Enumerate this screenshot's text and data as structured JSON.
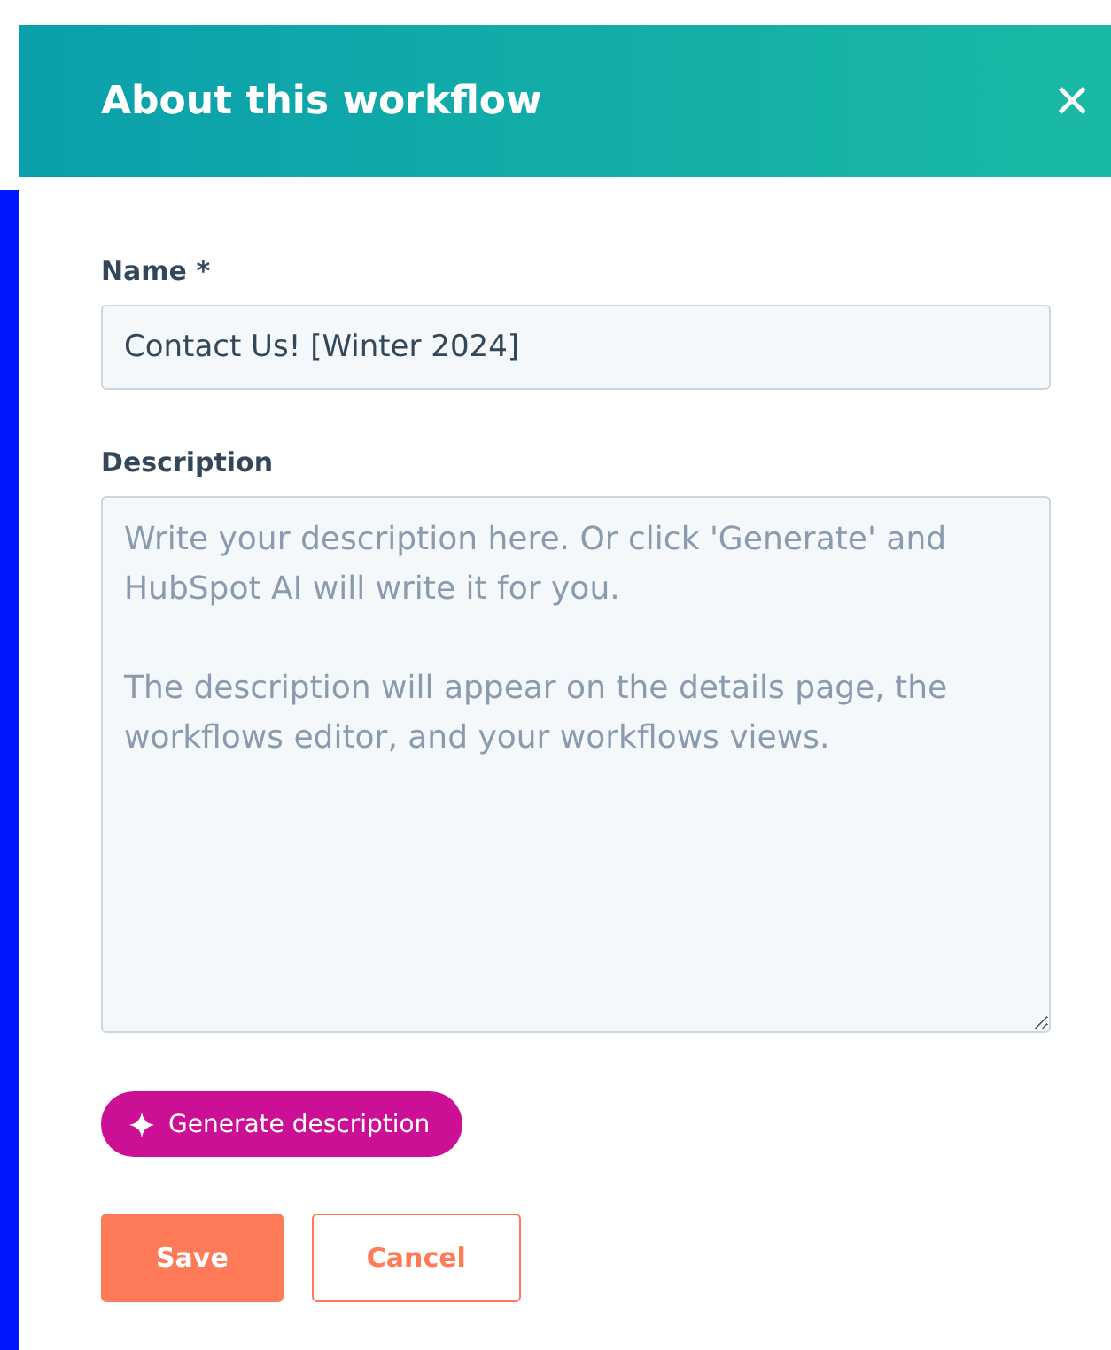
{
  "header": {
    "title": "About this workflow",
    "close": "×"
  },
  "name_field": {
    "label": "Name *",
    "value": "Contact Us! [Winter 2024]"
  },
  "description_field": {
    "label": "Description",
    "placeholder": "Write your description here. Or click 'Generate' and HubSpot AI will write it for you.\n\nThe description will appear on the details page, the workflows editor, and your workflows views."
  },
  "generate_button": {
    "label": "Generate description"
  },
  "buttons": [
    {
      "label": "Save",
      "kind": "primary"
    },
    {
      "label": "Cancel",
      "kind": "secondary"
    }
  ]
}
